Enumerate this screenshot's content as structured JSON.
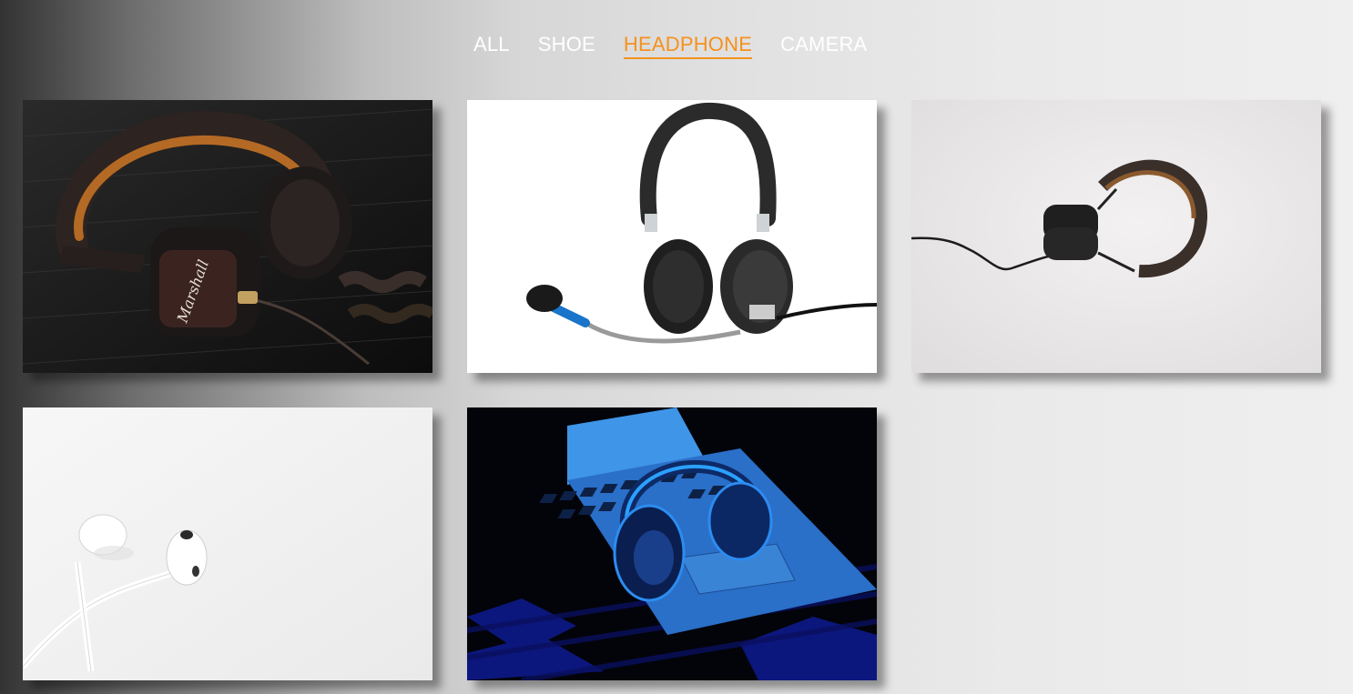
{
  "nav": {
    "items": [
      {
        "label": "ALL",
        "active": false
      },
      {
        "label": "SHOE",
        "active": false
      },
      {
        "label": "HEADPHONE",
        "active": true
      },
      {
        "label": "CAMERA",
        "active": false
      }
    ],
    "active_color": "#f5911e",
    "inactive_color": "#ffffff"
  },
  "gallery": {
    "category": "HEADPHONE",
    "items": [
      {
        "icon": "marshall-headphones-photo"
      },
      {
        "icon": "headset-with-microphone-photo"
      },
      {
        "icon": "headphones-on-white-photo"
      },
      {
        "icon": "white-earbuds-photo"
      },
      {
        "icon": "headphones-on-laptop-blue-photo"
      }
    ]
  }
}
